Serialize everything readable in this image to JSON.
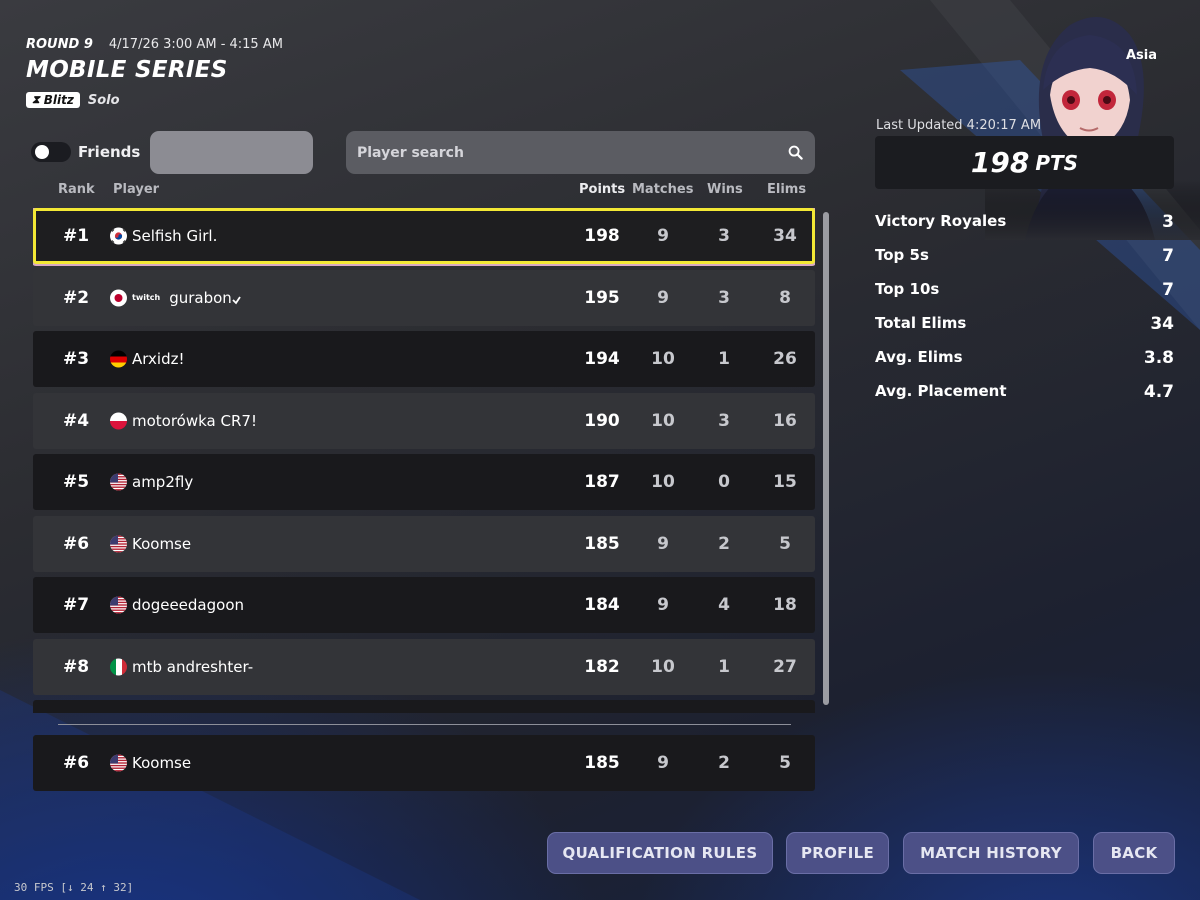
{
  "header": {
    "round_label": "ROUND 9",
    "round_time": "4/17/26 3:00 AM - 4:15 AM",
    "title": "MOBILE SERIES",
    "mode_badge": "Blitz",
    "mode_type": "Solo"
  },
  "controls": {
    "friends_label": "Friends",
    "friends_enabled": false,
    "search_placeholder": "Player search"
  },
  "columns": {
    "rank": "Rank",
    "player": "Player",
    "points": "Points",
    "matches": "Matches",
    "wins": "Wins",
    "elims": "Elims"
  },
  "leaderboard": [
    {
      "rank": "#1",
      "country": "kr",
      "name": "Selfish Girl.",
      "points": "198",
      "matches": "9",
      "wins": "3",
      "elims": "34",
      "selected": true
    },
    {
      "rank": "#2",
      "country": "jp",
      "prefix": "twitch",
      "name": "gurabon",
      "points": "195",
      "matches": "9",
      "wins": "3",
      "elims": "8"
    },
    {
      "rank": "#3",
      "country": "de",
      "name": "Arxidz!",
      "points": "194",
      "matches": "10",
      "wins": "1",
      "elims": "26"
    },
    {
      "rank": "#4",
      "country": "pl",
      "name": "motorówka CR7!",
      "points": "190",
      "matches": "10",
      "wins": "3",
      "elims": "16"
    },
    {
      "rank": "#5",
      "country": "us",
      "name": "amp2fly",
      "points": "187",
      "matches": "10",
      "wins": "0",
      "elims": "15"
    },
    {
      "rank": "#6",
      "country": "us",
      "name": "Koomse",
      "points": "185",
      "matches": "9",
      "wins": "2",
      "elims": "5"
    },
    {
      "rank": "#7",
      "country": "us",
      "name": "dogeeedagoon",
      "points": "184",
      "matches": "9",
      "wins": "4",
      "elims": "18"
    },
    {
      "rank": "#8",
      "country": "it",
      "name": "mtb andreshter-",
      "points": "182",
      "matches": "10",
      "wins": "1",
      "elims": "27"
    }
  ],
  "own_entry": {
    "rank": "#6",
    "country": "us",
    "name": "Koomse",
    "points": "185",
    "matches": "9",
    "wins": "2",
    "elims": "5"
  },
  "profile": {
    "region": "Asia",
    "last_updated": "Last Updated 4:20:17 AM",
    "points_value": "198",
    "points_unit": "PTS",
    "stats": [
      {
        "label": "Victory Royales",
        "value": "3"
      },
      {
        "label": "Top 5s",
        "value": "7"
      },
      {
        "label": "Top 10s",
        "value": "7"
      },
      {
        "label": "Total Elims",
        "value": "34"
      },
      {
        "label": "Avg. Elims",
        "value": "3.8"
      },
      {
        "label": "Avg. Placement",
        "value": "4.7"
      }
    ]
  },
  "buttons": {
    "qualification": "QUALIFICATION RULES",
    "profile": "PROFILE",
    "match_history": "MATCH HISTORY",
    "back": "BACK"
  },
  "fps_text": "30 FPS [↓ 24 ↑ 32]",
  "colors": {
    "selected_border": "#f3e835",
    "button_bg": "#4c5087",
    "row_dark": "#19191c",
    "row_light": "#333438"
  }
}
